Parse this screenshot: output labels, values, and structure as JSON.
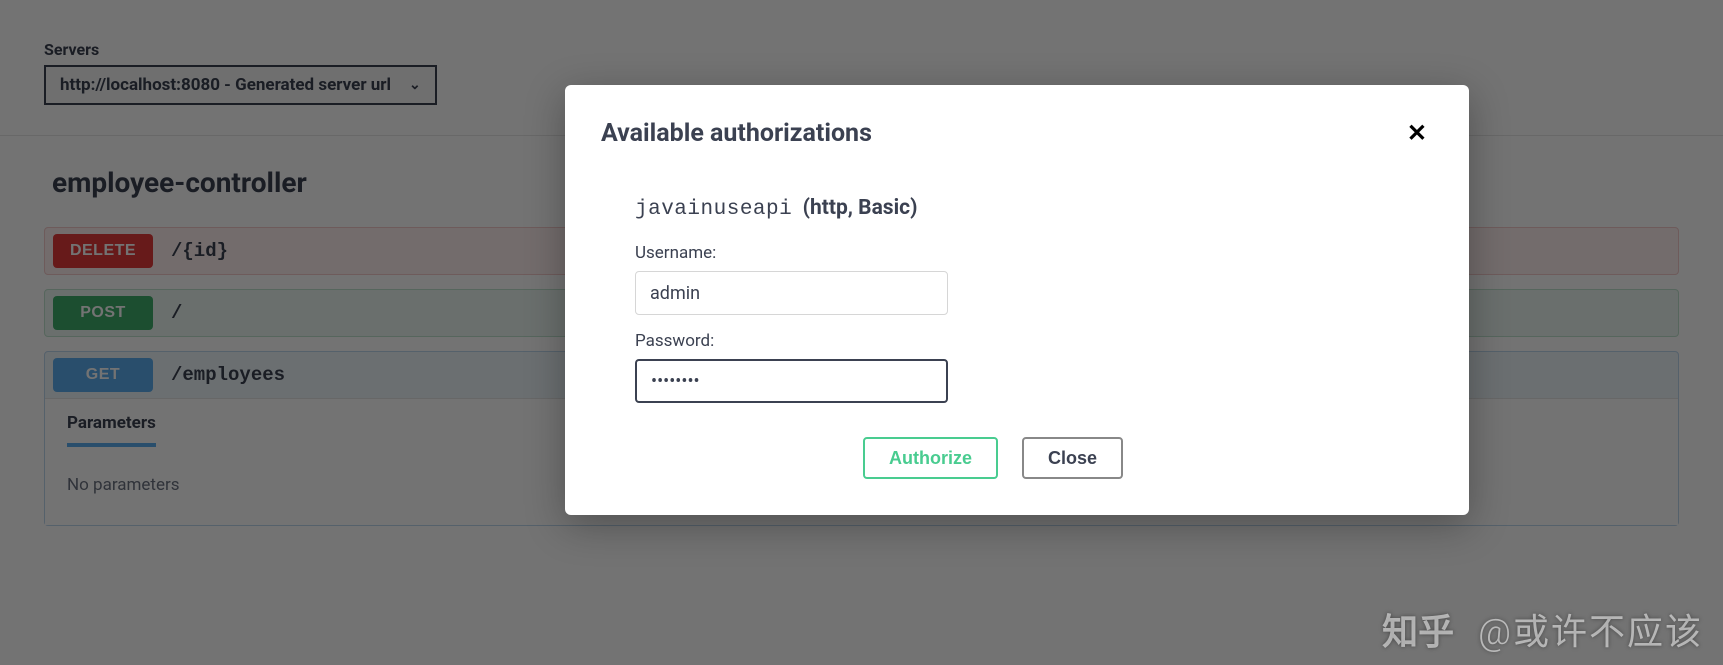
{
  "servers": {
    "label": "Servers",
    "selected": "http://localhost:8080 - Generated server url"
  },
  "tag": {
    "name": "employee-controller"
  },
  "ops": {
    "delete": {
      "method": "DELETE",
      "path": "/{id}"
    },
    "post": {
      "method": "POST",
      "path": "/"
    },
    "get": {
      "method": "GET",
      "path": "/employees"
    }
  },
  "params": {
    "title": "Parameters",
    "none": "No parameters"
  },
  "modal": {
    "title": "Available authorizations",
    "auth_name": "javainuseapi",
    "auth_type": "(http, Basic)",
    "username_label": "Username:",
    "username_value": "admin",
    "password_label": "Password:",
    "password_value": "password",
    "authorize_btn": "Authorize",
    "close_btn": "Close"
  },
  "watermark": {
    "logo": "知乎",
    "text": "@或许不应该"
  }
}
